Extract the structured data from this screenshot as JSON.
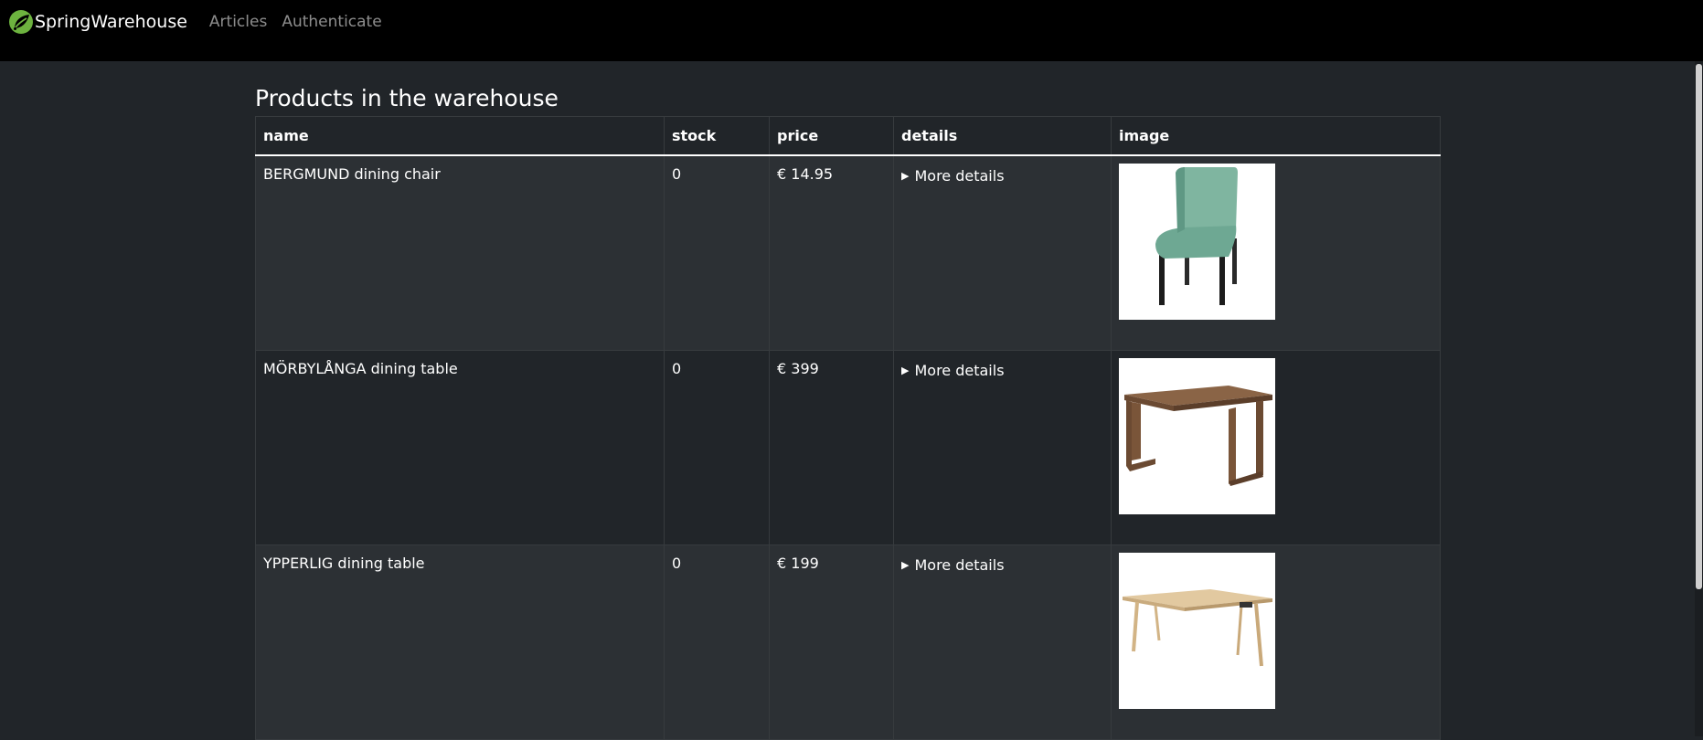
{
  "navbar": {
    "brand": "SpringWarehouse",
    "logo_icon": "spring-leaf-icon",
    "links": [
      "Articles",
      "Authenticate"
    ]
  },
  "page": {
    "title": "Products in the warehouse"
  },
  "table": {
    "headers": [
      "name",
      "stock",
      "price",
      "details",
      "image"
    ],
    "rows": [
      {
        "name": "BERGMUND dining chair",
        "stock": "0",
        "price": "€ 14.95",
        "details": "More details",
        "image": "chair-image"
      },
      {
        "name": "MÖRBYLÅNGA dining table",
        "stock": "0",
        "price": "€ 399",
        "details": "More details",
        "image": "walnut-table-image"
      },
      {
        "name": "YPPERLIG dining table",
        "stock": "0",
        "price": "€ 199",
        "details": "More details",
        "image": "ash-table-image"
      }
    ]
  },
  "colors": {
    "navbar_bg": "#000000",
    "page_bg": "#212529",
    "stripe_bg": "#2c3034",
    "brand_green": "#6db33f"
  }
}
